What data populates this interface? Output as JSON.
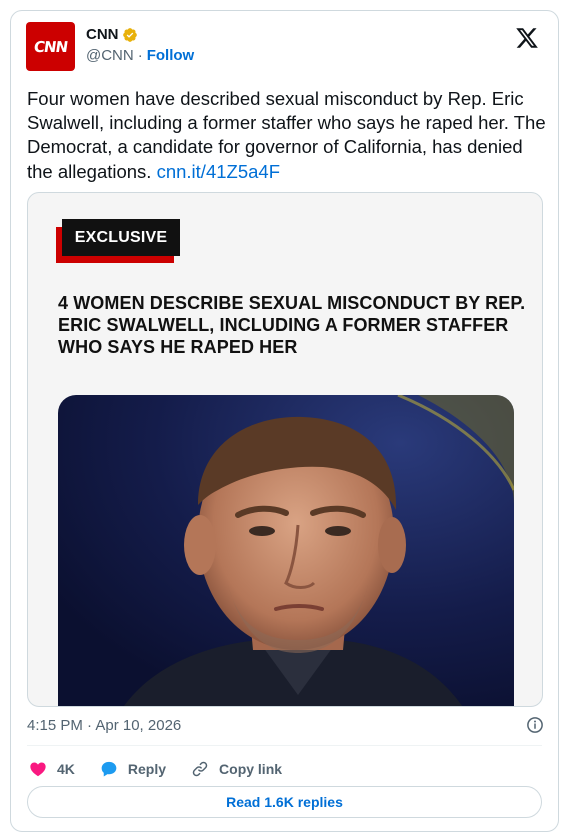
{
  "tweet": {
    "author": {
      "avatar_text": "CNN",
      "display_name": "CNN",
      "handle": "@CNN",
      "separator": "·",
      "follow_label": "Follow",
      "verified": true
    },
    "text": "Four women have described sexual misconduct by Rep. Eric Swalwell, including a former staffer who says he raped her. The Democrat, a candidate for governor of California, has denied the allegations.",
    "link_text": "cnn.it/41Z5a4F",
    "media": {
      "badge": "EXCLUSIVE",
      "headline": "4 WOMEN DESCRIBE SEXUAL MISCONDUCT BY REP. ERIC SWALWELL, INCLUDING A FORMER STAFFER WHO SAYS HE RAPED HER"
    },
    "timestamp": "4:15 PM · Apr 10, 2026",
    "actions": {
      "like_count": "4K",
      "reply_label": "Reply",
      "copy_link_label": "Copy link"
    },
    "read_replies_label": "Read 1.6K replies"
  },
  "colors": {
    "accent": "#006fd6",
    "brand_red": "#cc0000",
    "like": "#f91880",
    "verified_gold": "#e8b10a",
    "muted": "#536471"
  }
}
